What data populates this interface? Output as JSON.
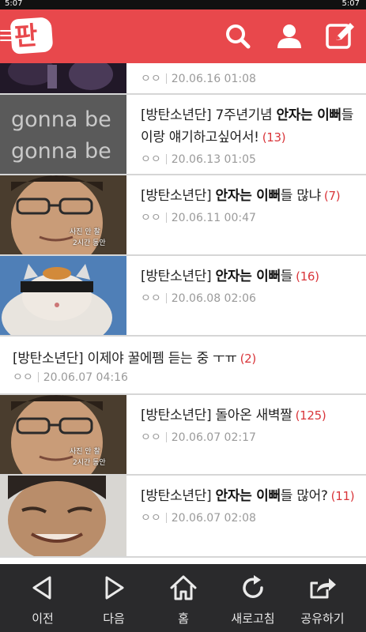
{
  "statusbar": {
    "left": "5:07",
    "right": "5:07"
  },
  "appbar": {
    "logo_text": "판",
    "icons": [
      "search-icon",
      "user-icon",
      "write-icon"
    ]
  },
  "items": [
    {
      "prefix": "",
      "highlight": "",
      "rest": "",
      "count": "",
      "author": "ㅇㅇ",
      "date": "20.06.16 01:08",
      "thumb": "dark-stage"
    },
    {
      "prefix": "[방탄소년단] 7주년기념 ",
      "highlight": "안자는 이뻐",
      "rest": "들이랑 얘기하고싶어서!",
      "count": "(13)",
      "author": "ㅇㅇ",
      "date": "20.06.13 01:05",
      "thumb": "gonna-text",
      "thumb_text": "gonna be"
    },
    {
      "prefix": "[방탄소년단] ",
      "highlight": "안자는 이뻐",
      "rest": "들 많냐",
      "count": "(7)",
      "author": "ㅇㅇ",
      "date": "20.06.11 00:47",
      "thumb": "man-face",
      "caption1": "사진 안 찰",
      "caption2": "2시간 동안"
    },
    {
      "prefix": "[방탄소년단] ",
      "highlight": "안자는 이뻐",
      "rest": "들",
      "count": "(16)",
      "author": "ㅇㅇ",
      "date": "20.06.08 02:06",
      "thumb": "cat"
    },
    {
      "prefix": "[방탄소년단] 이제야 꿀에펨 듣는 중 ㅜㅠ",
      "highlight": "",
      "rest": "",
      "count": "(2)",
      "author": "ㅇㅇ",
      "date": "20.06.07 04:16",
      "thumb": ""
    },
    {
      "prefix": "[방탄소년단] 돌아온 새벽짤",
      "highlight": "",
      "rest": "",
      "count": "(125)",
      "author": "ㅇㅇ",
      "date": "20.06.07 02:17",
      "thumb": "man-face",
      "caption1": "사진 안 찰",
      "caption2": "2시간 동안"
    },
    {
      "prefix": "[방탄소년단] ",
      "highlight": "안자는 이뻐",
      "rest": "들 많어?",
      "count": "(11)",
      "author": "ㅇㅇ",
      "date": "20.06.07 02:08",
      "thumb": "man-smile"
    }
  ],
  "bottombar": [
    {
      "label": "이전",
      "icon": "back-icon"
    },
    {
      "label": "다음",
      "icon": "forward-icon"
    },
    {
      "label": "홈",
      "icon": "home-icon"
    },
    {
      "label": "새로고침",
      "icon": "refresh-icon"
    },
    {
      "label": "공유하기",
      "icon": "share-icon"
    }
  ],
  "colors": {
    "accent": "#e8484c",
    "count": "#d9363b",
    "bottombar": "#2a2a2c"
  }
}
